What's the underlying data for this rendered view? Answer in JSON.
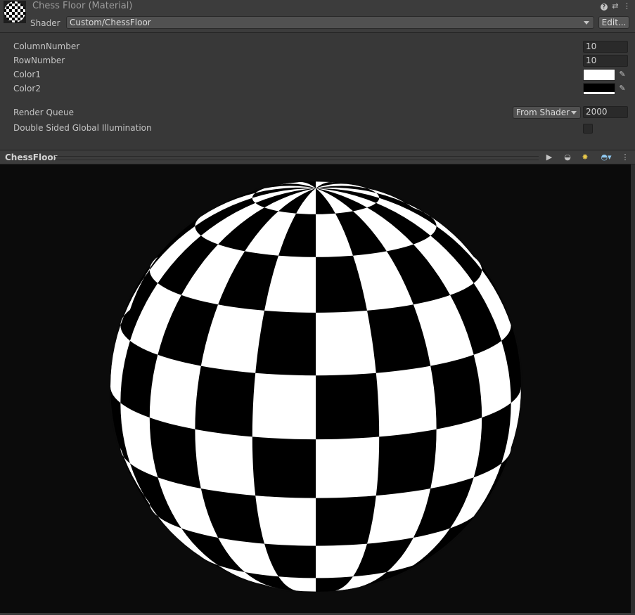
{
  "header": {
    "title": "Chess Floor (Material)",
    "shader_label": "Shader",
    "shader_value": "Custom/ChessFloor",
    "edit_label": "Edit..."
  },
  "properties": {
    "column_number": {
      "label": "ColumnNumber",
      "value": "10"
    },
    "row_number": {
      "label": "RowNumber",
      "value": "10"
    },
    "color1": {
      "label": "Color1",
      "color": "#ffffff"
    },
    "color2": {
      "label": "Color2",
      "color": "#000000"
    },
    "render_queue": {
      "label": "Render Queue",
      "option": "From Shader",
      "value": "2000"
    },
    "dsgi": {
      "label": "Double Sided Global Illumination",
      "checked": false
    }
  },
  "preview": {
    "title": "ChessFloor",
    "grid": {
      "columns": 10,
      "rows": 10
    },
    "colors": {
      "light": "#ffffff",
      "dark": "#000000",
      "background": "#0b0b0b"
    }
  },
  "icons": {
    "help": "help-icon",
    "settings": "sliders-icon",
    "menu": "kebab-menu-icon",
    "play": "play-icon",
    "sphere": "sphere-mesh-icon",
    "light": "lights-icon",
    "skybox": "skybox-icon",
    "picker": "eyedropper-icon"
  }
}
